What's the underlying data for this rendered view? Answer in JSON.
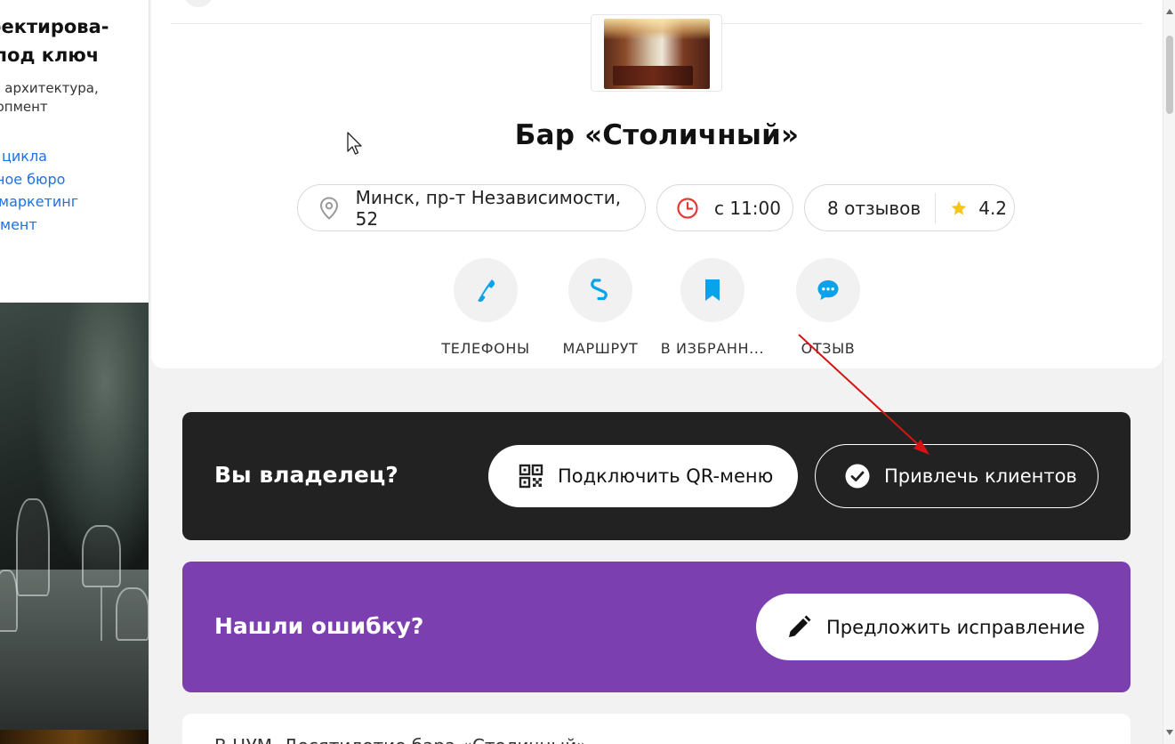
{
  "ad": {
    "title_line1": "роектирова-",
    "title_line2": "з под ключ",
    "desc_line1": "й, архитектура,",
    "desc_line2": "лопмент",
    "links": [
      "цикла",
      "ное бюро",
      "маркетинг",
      "мент"
    ]
  },
  "place": {
    "title": "Бар «Столичный»",
    "address": "Минск, пр-т Независимости, 52",
    "hours": "с 11:00",
    "reviews": "8 отзывов",
    "rating": "4.2"
  },
  "actions": {
    "phones": "ТЕЛЕФОНЫ",
    "route": "МАРШРУТ",
    "favorites": "В ИЗБРАНН...",
    "review": "ОТЗЫВ"
  },
  "owner": {
    "title": "Вы владелец?",
    "qr_label": "Подключить QR-меню",
    "clients_label": "Привлечь клиентов"
  },
  "error": {
    "title": "Нашли ошибку?",
    "fix_label": "Предложить исправление"
  },
  "bottom": {
    "text": "В                                                             ЦУМ. Десятилетие бара «Столичный» ..."
  },
  "colors": {
    "accent_blue": "#0aa2e8",
    "clock_red": "#e53935",
    "star_gold": "#f5c518",
    "owner_bg": "#222222",
    "error_bg": "#7b3fb0",
    "annotation_red": "#d41414"
  },
  "icons": {
    "location": "map-pin-icon",
    "clock": "clock-icon",
    "star": "star-icon",
    "phone": "phone-icon",
    "route": "route-icon",
    "bookmark": "bookmark-icon",
    "chat": "chat-bubble-icon",
    "qr": "qr-code-icon",
    "check": "check-circle-icon",
    "pencil": "pencil-icon"
  }
}
